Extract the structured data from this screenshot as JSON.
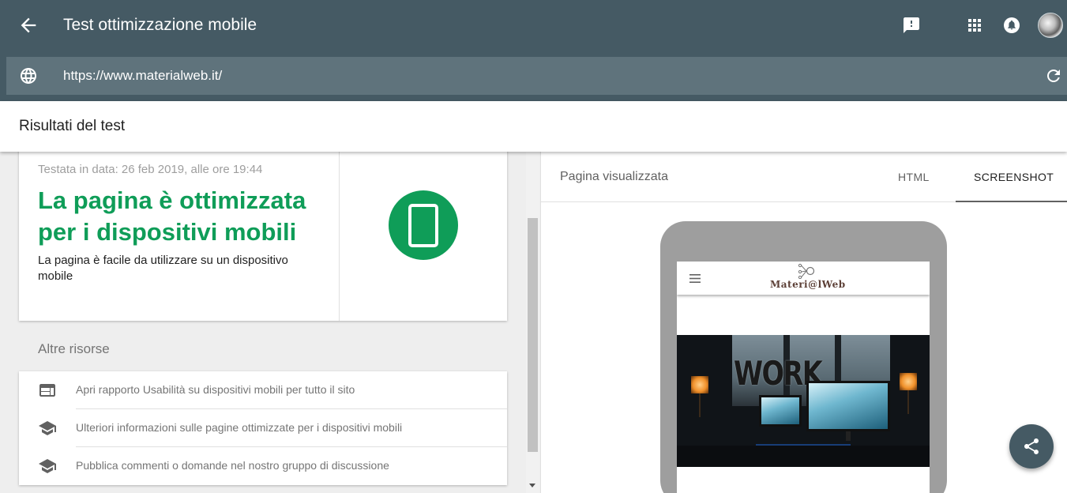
{
  "app": {
    "title": "Test ottimizzazione mobile",
    "url": "https://www.materialweb.it/"
  },
  "header": {
    "section_title": "Risultati del test"
  },
  "result": {
    "tested_date": "Testata in data: 26 feb 2019, alle ore 19:44",
    "title": "La pagina è ottimizzata per i dispositivi mobili",
    "description": "La pagina è facile da utilizzare su un dispositivo mobile",
    "status_color": "#0f9d58"
  },
  "resources": {
    "title": "Altre risorse",
    "items": [
      {
        "icon": "web-icon",
        "label": "Apri rapporto Usabilità su dispositivi mobili per tutto il sito"
      },
      {
        "icon": "school-icon",
        "label": "Ulteriori informazioni sulle pagine ottimizzate per i dispositivi mobili"
      },
      {
        "icon": "school-icon",
        "label": "Pubblica commenti o domande nel nostro gruppo di discussione"
      }
    ]
  },
  "preview": {
    "rendered_label": "Pagina visualizzata",
    "tabs": [
      {
        "label": "HTML",
        "active": false
      },
      {
        "label": "SCREENSHOT",
        "active": true
      }
    ],
    "site_logo": "Materi@lWeb",
    "hero_word": "WORK"
  },
  "colors": {
    "app_bar": "#455a64",
    "url_bar": "#5f737c",
    "accent_green": "#0f9d58"
  }
}
